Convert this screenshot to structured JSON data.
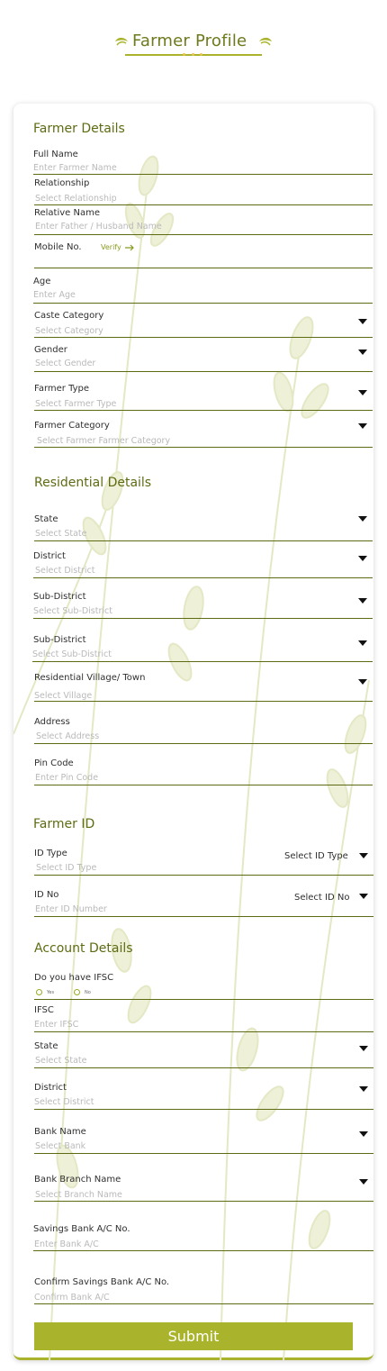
{
  "header": {
    "title": "Farmer Profile"
  },
  "sections": {
    "farmer_details": "Farmer Details",
    "residential_details": "Residential Details",
    "farmer_id": "Farmer ID",
    "account_details": "Account Details"
  },
  "farmer": {
    "full_name": {
      "label": "Full Name",
      "placeholder": "Enter Farmer Name"
    },
    "relationship": {
      "label": "Relationship",
      "placeholder": "Select  Relationship"
    },
    "relative_name": {
      "label": "Relative Name",
      "placeholder": "Enter Father / Husband Name"
    },
    "mobile": {
      "label": "Mobile No.",
      "verify": "Verify"
    },
    "age": {
      "label": "Age",
      "placeholder": "Enter Age"
    },
    "caste": {
      "label": "Caste Category",
      "placeholder": "Select  Category"
    },
    "gender": {
      "label": "Gender",
      "placeholder": "Select  Gender"
    },
    "farmer_type": {
      "label": "Farmer Type",
      "placeholder": "Select  Farmer Type"
    },
    "farmer_category": {
      "label": "Farmer Category",
      "placeholder": "Select  Farmer Farmer Category"
    }
  },
  "residential": {
    "state": {
      "label": "State",
      "placeholder": "Select State"
    },
    "district": {
      "label": "District",
      "placeholder": "Select District"
    },
    "sub_district_1": {
      "label": "Sub-District",
      "placeholder": "Select Sub-District"
    },
    "sub_district_2": {
      "label": "Sub-District",
      "placeholder": "Select Sub-District"
    },
    "village": {
      "label": "Residential Village/ Town",
      "placeholder": "Select Village"
    },
    "address": {
      "label": "Address",
      "placeholder": "Select Address"
    },
    "pin": {
      "label": "Pin Code",
      "placeholder": "Enter Pin Code"
    }
  },
  "farmer_id": {
    "id_type": {
      "label": "ID Type",
      "placeholder": "Select ID Type",
      "select": "Select  ID Type"
    },
    "id_no": {
      "label": "ID No",
      "placeholder": "Enter ID Number",
      "select": "Select  ID No"
    }
  },
  "account": {
    "ifsc_question": {
      "label": "Do you have IFSC",
      "yes": "Yes",
      "no": "No"
    },
    "ifsc": {
      "label": "IFSC",
      "placeholder": "Enter IFSC"
    },
    "state": {
      "label": "State",
      "placeholder": "Select State"
    },
    "district": {
      "label": "District",
      "placeholder": "Select District"
    },
    "bank_name": {
      "label": "Bank Name",
      "placeholder": "Select Bank"
    },
    "branch": {
      "label": "Bank Branch Name",
      "placeholder": "Select Branch Name"
    },
    "account_no": {
      "label": "Savings Bank A/C No.",
      "placeholder": "Enter Bank A/C"
    },
    "confirm_account_no": {
      "label": "Confirm Savings Bank A/C No.",
      "placeholder": "Confirm Bank A/C"
    }
  },
  "submit_label": "Submit",
  "colors": {
    "accent": "#a9b42c",
    "heading": "#5f6b12",
    "line": "#5f6b12"
  }
}
